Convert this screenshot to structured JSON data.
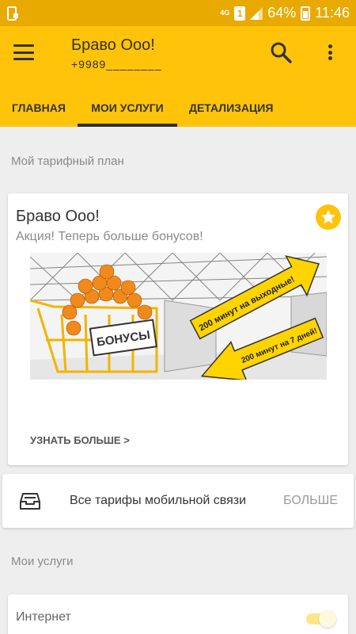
{
  "status_bar": {
    "network": "4G",
    "sim": "1",
    "battery": "64%",
    "time": "11:46"
  },
  "header": {
    "title": "Браво Ооо!",
    "phone": "+9989________",
    "tabs": [
      {
        "label": "ГЛАВНАЯ"
      },
      {
        "label": "МОИ УСЛУГИ"
      },
      {
        "label": "ДЕТАЛИЗАЦИЯ"
      }
    ],
    "active_tab": "МОИ УСЛУГИ"
  },
  "tariff_section": {
    "heading": "Мой тарифный план",
    "plan_name": "Браво Ооо!",
    "promo": "Акция! Теперь больше бонусов!",
    "banner": {
      "sign": "БОНУСЫ",
      "arrow1": "200 минут на выходные!",
      "arrow2": "200 минут на 7 дней!"
    },
    "learn_more": "УЗНАТЬ БОЛЬШЕ >"
  },
  "all_tariffs": {
    "label": "Все тарифы мобильной связи",
    "action": "БОЛЬШЕ"
  },
  "services_section": {
    "heading": "Мои услуги",
    "items": [
      {
        "label": "Интернет",
        "enabled": true
      }
    ]
  },
  "colors": {
    "brand_yellow": "#ffc40a",
    "status_bar": "#e8aa00",
    "background": "#eeeeee"
  },
  "icons": [
    "menu-icon",
    "search-icon",
    "more-vert-icon",
    "star-icon",
    "inbox-icon"
  ]
}
